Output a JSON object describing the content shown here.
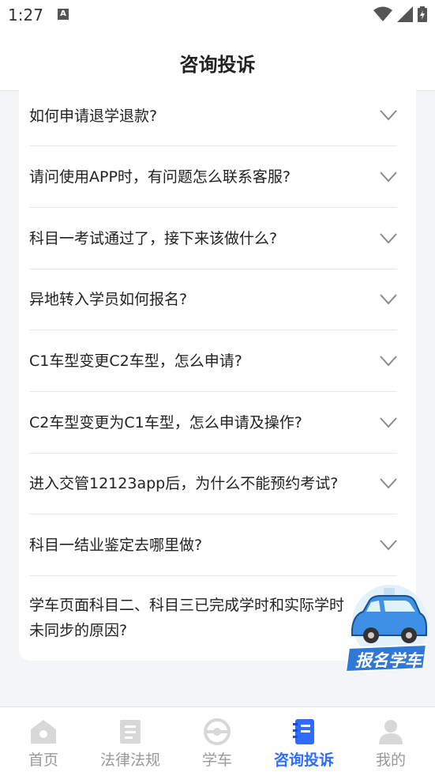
{
  "status_bar": {
    "time": "1:27",
    "notification_letter": "A"
  },
  "header": {
    "title": "咨询投诉"
  },
  "faq": {
    "items": [
      {
        "question": "如何申请退学退款?"
      },
      {
        "question": "请问使用APP时，有问题怎么联系客服?"
      },
      {
        "question": "科目一考试通过了，接下来该做什么?"
      },
      {
        "question": "异地转入学员如何报名?"
      },
      {
        "question": "C1车型变更C2车型，怎么申请?"
      },
      {
        "question": "C2车型变更为C1车型，怎么申请及操作?"
      },
      {
        "question": "进入交管12123app后，为什么不能预约考试?"
      },
      {
        "question": "科目一结业鉴定去哪里做?"
      },
      {
        "question": "学车页面科目二、科目三已完成学时和实际学时未同步的原因?"
      }
    ]
  },
  "floating_button": {
    "label": "报名学车"
  },
  "tabbar": {
    "tabs": [
      {
        "label": "首页",
        "icon": "home-icon",
        "active": false
      },
      {
        "label": "法律法规",
        "icon": "law-book-icon",
        "active": false
      },
      {
        "label": "学车",
        "icon": "steering-wheel-icon",
        "active": false
      },
      {
        "label": "咨询投诉",
        "icon": "notebook-icon",
        "active": true
      },
      {
        "label": "我的",
        "icon": "user-icon",
        "active": false
      }
    ]
  },
  "colors": {
    "accent": "#2f6bff",
    "inactive": "#9a9a9a",
    "background": "#f4f5f7"
  }
}
